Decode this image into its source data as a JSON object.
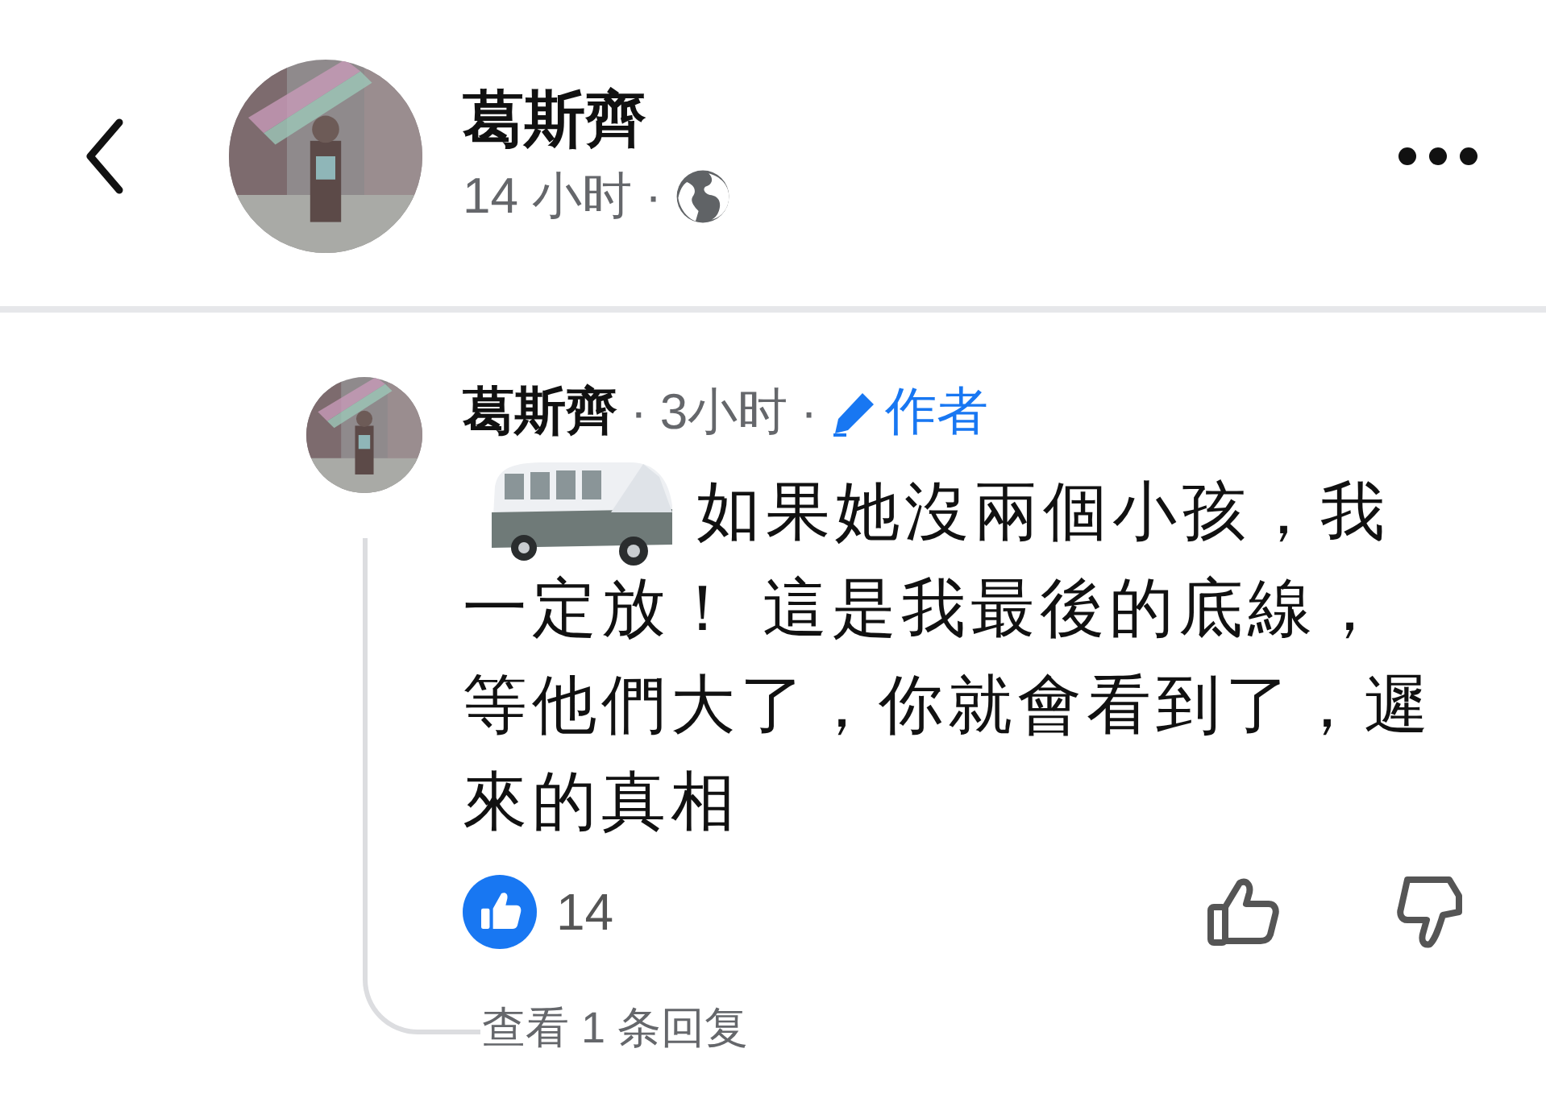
{
  "header": {
    "author": "葛斯齊",
    "time": "14 小时",
    "separator": "·"
  },
  "comment": {
    "author": "葛斯齊",
    "separator_1": "·",
    "time": "3小时",
    "separator_2": "·",
    "badge": "作者",
    "text_lines": [
      "如果她沒兩個小孩，我",
      "一定放！ 這是我最後的底線，",
      "等他們大了，你就會看到了，遲",
      "來的真相"
    ],
    "reaction_count": "14",
    "replies_link": "查看 1 条回复"
  }
}
